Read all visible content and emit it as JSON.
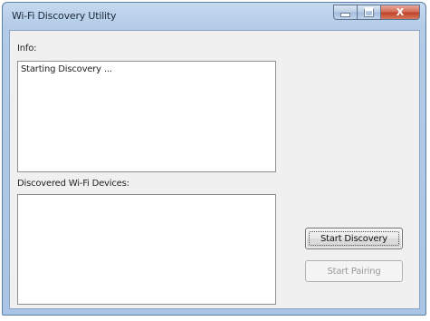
{
  "window": {
    "title": "Wi-Fi Discovery Utility",
    "close_label": "X"
  },
  "info": {
    "label": "Info:",
    "log_text": "Starting Discovery ..."
  },
  "devices": {
    "label": "Discovered Wi-Fi Devices:",
    "items": []
  },
  "buttons": {
    "start_discovery": "Start Discovery",
    "start_pairing": "Start Pairing",
    "start_pairing_enabled": false
  },
  "colors": {
    "frame": "#a9c4e4",
    "close_button": "#c0432b",
    "client_background": "#f0f0f0"
  },
  "icons": {
    "minimize": "minimize-icon",
    "maximize": "maximize-icon",
    "close": "close-icon"
  }
}
